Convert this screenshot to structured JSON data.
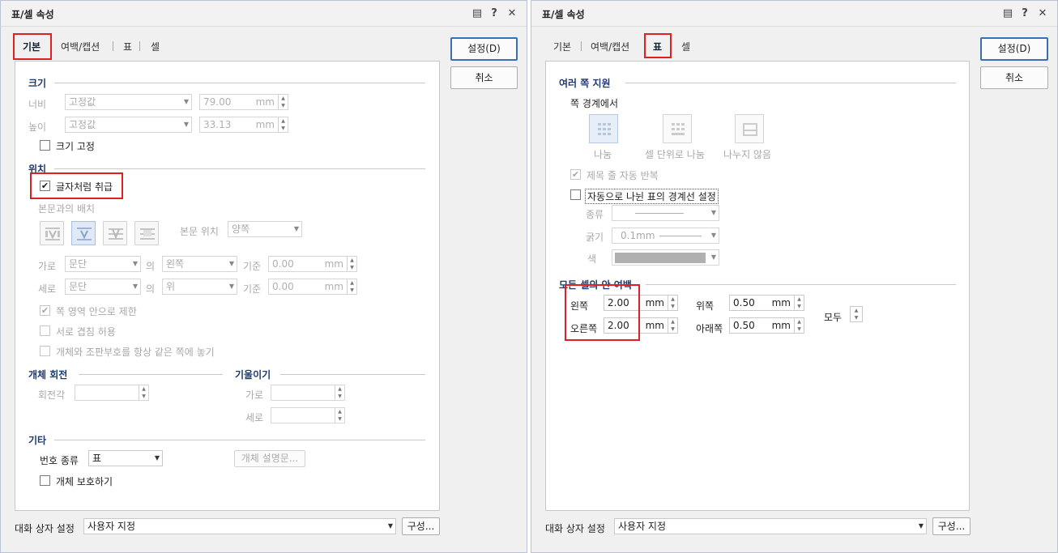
{
  "left_dialog": {
    "title": "표/셀 속성",
    "tabs": [
      "기본",
      "여백/캡션",
      "표",
      "셀"
    ],
    "active_tab": "기본",
    "buttons": {
      "ok": "설정(D)",
      "cancel": "취소"
    },
    "size": {
      "heading": "크기",
      "width_label": "너비",
      "width_mode": "고정값",
      "width_value": "79.00",
      "height_label": "높이",
      "height_mode": "고정값",
      "height_value": "33.13",
      "unit": "mm",
      "fixed_label": "크기 고정"
    },
    "position": {
      "heading": "위치",
      "treat_as_char": "글자처럼 취급",
      "placement_label": "본문과의 배치",
      "body_pos_label": "본문 위치",
      "body_pos_value": "양쪽",
      "horiz_label": "가로",
      "horiz_ref": "문단",
      "of_label": "의",
      "horiz_dir": "왼쪽",
      "base_label": "기준",
      "horiz_value": "0.00",
      "vert_label": "세로",
      "vert_ref": "문단",
      "vert_dir": "위",
      "vert_value": "0.00",
      "unit": "mm",
      "limit_page": "쪽 영역 안으로 제한",
      "allow_overlap": "서로 겹침 허용",
      "same_page": "개체와 조판부호를 항상 같은 쪽에 놓기"
    },
    "rotation": {
      "heading": "개체 회전",
      "angle_label": "회전각"
    },
    "skew": {
      "heading": "기울이기",
      "horiz_label": "가로",
      "vert_label": "세로"
    },
    "misc": {
      "heading": "기타",
      "number_type_label": "번호 종류",
      "number_type_value": "표",
      "desc_button": "개체 설명문...",
      "protect_label": "개체 보호하기"
    },
    "footer": {
      "label": "대화 상자 설정",
      "value": "사용자 지정",
      "config_button": "구성..."
    }
  },
  "right_dialog": {
    "title": "표/셀 속성",
    "tabs": [
      "기본",
      "여백/캡션",
      "표",
      "셀"
    ],
    "active_tab": "표",
    "buttons": {
      "ok": "설정(D)",
      "cancel": "취소"
    },
    "multi_page": {
      "heading": "여러 쪽 지원",
      "boundary_label": "쪽 경계에서",
      "options": [
        "나눔",
        "셀 단위로 나눔",
        "나누지 않음"
      ],
      "repeat_header": "제목 줄 자동 반복",
      "auto_border": "자동으로 나뉜 표의 경계선 설정",
      "type_label": "종류",
      "thickness_label": "굵기",
      "thickness_value": "0.1mm",
      "color_label": "색"
    },
    "cell_margin": {
      "heading": "모든 셀의 안 여백",
      "left_label": "왼쪽",
      "left_value": "2.00",
      "right_label": "오른쪽",
      "right_value": "2.00",
      "top_label": "위쪽",
      "top_value": "0.50",
      "bottom_label": "아래쪽",
      "bottom_value": "0.50",
      "unit": "mm",
      "all_label": "모두"
    },
    "footer": {
      "label": "대화 상자 설정",
      "value": "사용자 지정",
      "config_button": "구성..."
    }
  },
  "colors": {
    "highlight": "#e02020",
    "section_heading": "#1f3a6e",
    "primary_border": "#3a6fb5"
  },
  "icons": [
    "comment-icon",
    "help-icon",
    "close-icon",
    "check-icon",
    "wrap-layout-icons",
    "table-split-icons"
  ]
}
